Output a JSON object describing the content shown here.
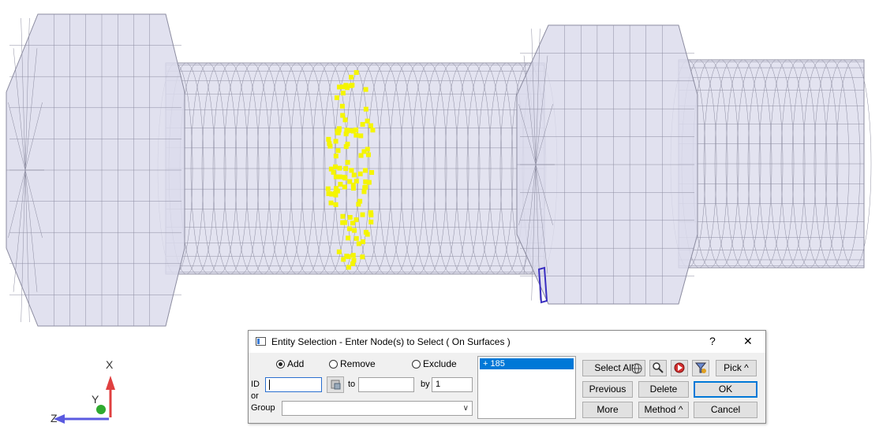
{
  "viewport": {
    "axis_labels": {
      "x": "X",
      "y": "Y",
      "z": "Z"
    },
    "colors": {
      "mesh_fill": "#dcdcec",
      "mesh_line": "#8c8ca0",
      "selected_nodes": "#f5f500",
      "highlight": "#3a2fc0"
    }
  },
  "dialog": {
    "title": "Entity Selection - Enter Node(s) to Select  ( On Surfaces )",
    "help_label": "?",
    "close_label": "✕",
    "mode": {
      "add": "Add",
      "remove": "Remove",
      "exclude": "Exclude",
      "selected": "add"
    },
    "id_label": "ID",
    "or_label": "or",
    "group_label": "Group",
    "id_value": "",
    "to_label": "to",
    "to_value": "",
    "by_label": "by",
    "by_value": "1",
    "group_value": "",
    "selection_list": [
      "+   185"
    ],
    "buttons": {
      "select_all": "Select All",
      "pick": "Pick ^",
      "previous": "Previous",
      "delete": "Delete",
      "ok": "OK",
      "more": "More",
      "method": "Method ^",
      "cancel": "Cancel"
    },
    "icons": [
      "globe-icon",
      "zoom-icon",
      "highlight-icon",
      "filter-icon"
    ]
  }
}
